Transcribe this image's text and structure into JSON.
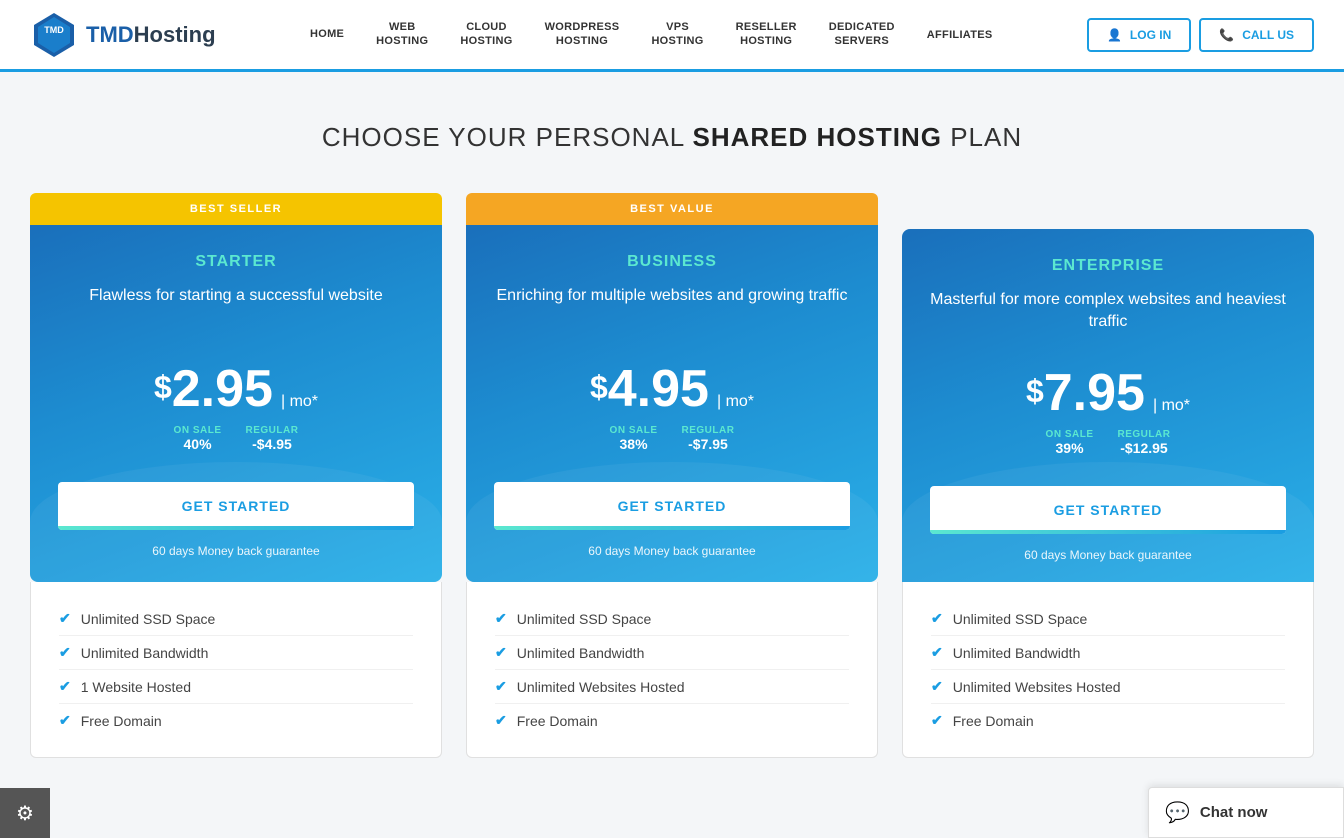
{
  "header": {
    "logo_text_tmd": "TMD",
    "logo_text_hosting": "Hosting",
    "nav_items": [
      {
        "label": "HOME",
        "id": "home"
      },
      {
        "label": "WEB\nHOSTING",
        "id": "web-hosting"
      },
      {
        "label": "CLOUD\nHOSTING",
        "id": "cloud-hosting"
      },
      {
        "label": "WORDPRESS\nHOSTING",
        "id": "wordpress-hosting"
      },
      {
        "label": "VPS\nHOSTING",
        "id": "vps-hosting"
      },
      {
        "label": "RESELLER\nHOSTING",
        "id": "reseller-hosting"
      },
      {
        "label": "DEDICATED\nSERVERS",
        "id": "dedicated-servers"
      },
      {
        "label": "AFFILIATES",
        "id": "affiliates"
      }
    ],
    "login_label": "LOG IN",
    "callus_label": "CALL US"
  },
  "page_title_prefix": "CHOOSE YOUR PERSONAL ",
  "page_title_bold": "SHARED HOSTING",
  "page_title_suffix": " PLAN",
  "plans": [
    {
      "id": "starter",
      "badge": "BEST SELLER",
      "badge_type": "yellow",
      "name": "STARTER",
      "description": "Flawless for starting a successful website",
      "price": "2.95",
      "price_per": "mo*",
      "on_sale_label": "ON SALE",
      "on_sale_value": "40%",
      "regular_label": "REGULAR",
      "regular_value": "-$4.95",
      "cta": "GET STARTED",
      "money_back": "60 days Money back guarantee",
      "features": [
        "Unlimited SSD Space",
        "Unlimited Bandwidth",
        "1 Website Hosted",
        "Free Domain"
      ]
    },
    {
      "id": "business",
      "badge": "BEST VALUE",
      "badge_type": "orange",
      "name": "BUSINESS",
      "description": "Enriching for multiple websites and growing traffic",
      "price": "4.95",
      "price_per": "mo*",
      "on_sale_label": "ON SALE",
      "on_sale_value": "38%",
      "regular_label": "REGULAR",
      "regular_value": "-$7.95",
      "cta": "GET STARTED",
      "money_back": "60 days Money back guarantee",
      "features": [
        "Unlimited SSD Space",
        "Unlimited Bandwidth",
        "Unlimited Websites Hosted",
        "Free Domain"
      ]
    },
    {
      "id": "enterprise",
      "badge": "",
      "badge_type": "none",
      "name": "ENTERPRISE",
      "description": "Masterful for more complex websites and heaviest traffic",
      "price": "7.95",
      "price_per": "mo*",
      "on_sale_label": "ON SALE",
      "on_sale_value": "39%",
      "regular_label": "REGULAR",
      "regular_value": "-$12.95",
      "cta": "GET STARTED",
      "money_back": "60 days Money back guarantee",
      "features": [
        "Unlimited SSD Space",
        "Unlimited Bandwidth",
        "Unlimited Websites Hosted",
        "Free Domain"
      ]
    }
  ],
  "chat": {
    "label": "Chat now"
  },
  "settings": {
    "icon": "⚙"
  }
}
